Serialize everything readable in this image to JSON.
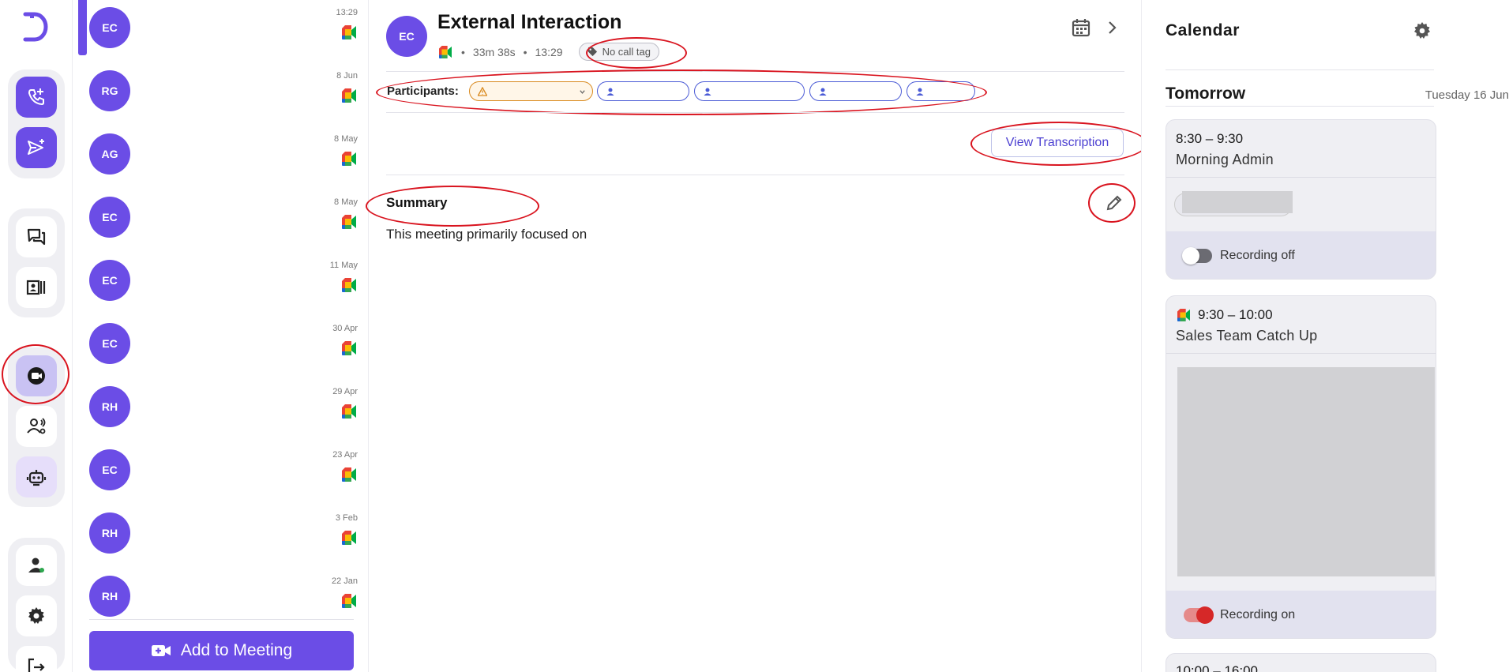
{
  "meetings": [
    {
      "initials": "EC",
      "date": "13:29"
    },
    {
      "initials": "RG",
      "date": "8 Jun"
    },
    {
      "initials": "AG",
      "date": "8 May"
    },
    {
      "initials": "EC",
      "date": "8 May"
    },
    {
      "initials": "EC",
      "date": "11 May"
    },
    {
      "initials": "EC",
      "date": "30 Apr"
    },
    {
      "initials": "RH",
      "date": "29 Apr"
    },
    {
      "initials": "EC",
      "date": "23 Apr"
    },
    {
      "initials": "RH",
      "date": "3 Feb"
    },
    {
      "initials": "RH",
      "date": "22 Jan"
    }
  ],
  "add_button": "Add to Meeting",
  "meeting": {
    "initials": "EC",
    "title": "External Interaction",
    "duration": "33m 38s",
    "time": "13:29",
    "call_tag": "No call tag",
    "participants_label": "Participants:",
    "view_transcription": "View Transcription",
    "summary_heading": "Summary",
    "summary_text": "This meeting primarily focused on"
  },
  "calendar": {
    "title": "Calendar",
    "day_label": "Tomorrow",
    "day_date": "Tuesday 16 Jun",
    "events": [
      {
        "time": "8:30 – 9:30",
        "name": "Morning Admin",
        "recording": "Recording off"
      },
      {
        "time": "9:30 – 10:00",
        "name": "Sales Team Catch Up",
        "recording": "Recording on"
      },
      {
        "time": "10:00 – 16:00"
      }
    ]
  },
  "icons": [
    "d-logo-icon",
    "call-add-icon",
    "send-add-icon",
    "chat-icon",
    "contacts-icon",
    "video-icon",
    "users-voice-icon",
    "bot-icon",
    "user-status-icon",
    "settings-icon",
    "logout-icon",
    "google-meet-icon",
    "tag-icon",
    "calendar-icon",
    "chevron-right-icon",
    "pencil-icon",
    "gear-icon",
    "person-icon",
    "warning-icon",
    "video-add-icon"
  ],
  "colors": {
    "accent": "#6b4de6",
    "annotation": "#d9141f",
    "recording_on": "#d62828"
  }
}
